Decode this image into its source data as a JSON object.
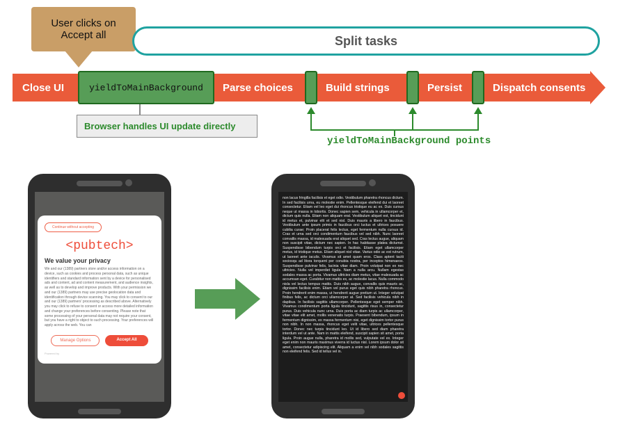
{
  "callout": {
    "text": "User clicks on Accept all"
  },
  "split_tasks_label": "Split tasks",
  "timeline": {
    "close_ui": "Close UI",
    "yield_main": "yieldToMainBackground",
    "parse_choices": "Parse choices",
    "build_strings": "Build strings",
    "persist": "Persist",
    "dispatch": "Dispatch consents"
  },
  "info_box": "Browser handles UI update directly",
  "points_label": "yieldToMainBackground points",
  "consent_dialog": {
    "top_button": "Continue without accepting",
    "logo": "<pubtech>",
    "title": "We value your privacy",
    "body": "We and our (1389) partners store and/or access information on a device, such as cookies and process personal data, such as unique identifiers and standard information sent by a device for personalised ads and content, ad and content measurement, and audience insights, as well as to develop and improve products. With your permission we and our (1389) partners may use precise geolocation data and identification through device scanning. You may click to consent to our and our (1389) partners' processing as described above. Alternatively you may click to refuse to consent or access more detailed information and change your preferences before consenting. Please note that some processing of your personal data may not require your consent, but you have a right to object to such processing. Your preferences will apply across the web. You can",
    "manage": "Manage Options",
    "accept": "Accept All",
    "powered": "Powered by"
  },
  "right_text": "non lacus fringilla facilisis et eget odio. Vestibulum pharetra rhoncus dictum. In sed facilisis urna, eu molestie enim. Pellentesque eleifend dui et laoreet consectetur. Etiam vel leo eget dui rhoncus tristique eu ac ex. Duis cursus neque ut massa in lobortis. Donec sapien sem, vehicula in ullamcorper et, dictum quis nulla. Etiam non aliquam erat. Vestibulum aliquet est, tincidunt id metus et, pulvinar elit et sed nisl. Duis mauris a libero in faucibus. Vestibulum ante ipsum primis in faucibus orci luctus et ultrices posuere cubilia curae; Proin placerat felis lectus, eget fermentum nulla cursus id. Cras et urna sed orci condimentum faucibus vel sed nibh. Nunc laoreet convallis massa, id malesuada erat aliquet sed. Cras lectus augue, aliquam non suscipit vitae, dictum nec sapien. In hac habitasse platea dictumst. Suspendisse bibendum turpis orci et facilisis. Etiam eget ullamcorper metus, id tristique metus. Etiam aliquet nisl vitae. Varius odio ac est rutrum, ut laoreet ante iaculis. Vivamus sit amet quam eros. Class aptent taciti sociosqu ad litora torquent per conubia nostra, per inceptos himenaeos. Suspendisse pulvinar felis, lacinia vitae diam. Proin volutpat non ex nec ultricies. Nulla vel imperdiet ligula. Nam a nulla arcu. Nullam egestas sodales massa ac porta. Vivamus ultricies diam metus, vitae malesuada ac accumsan eget. Curabitur non mattis ex, ac molestie lacus. Nulla commodo nisla vel lectus tempus mattis. Duis nibh augue, convallis quis mauris ac, dignissim facilisis enim. Etiam vel purus eget quis nibh pharetra rhoncus. Proin hendrerit enim massa, ut hendrerit augue pretium ut. Integer volutpat finibus felis, ac dictum orci ullamcorper at. Sed facilisis vehicula nibh in dapibus. In facilisis sagittis ullamcorper. Pellentesque eget semper nibh. Vivamus condimentum porta ligula tincidunt, sagittis risus in, consectetur purus. Duis vehicula nunc urna. Duis porta ac diam turpis ac ullamcorper, vitae vitae elit amet, mollis venenatis turpis. Praesent bibendum, ipsum in fermentum dignissim, ex massa fermentum nisi, eget dignissim tortor purus non nibh. In non massa, rhoncus eget velit vitae, ultrices pellentesque tortor. Donec nec turpis tincidunt leo. Ut id libero sed diam pharetra interdum vel ut ante. Nam in mattis eleifend, suscipit sapien sit amet, porta ligula. Proin augue nulla, pharetra id mollis sed, vulputate vel ex. Integer eget enim non mauris maximus viverra id luctus nisl. Lorem ipsum dolor sit amet, consectetur adipiscing elit. Aliquam a enim vel nibh sodales sagittis non eleifend felis. Sed id tellus vel in.",
  "colors": {
    "orange": "#EA5B3A",
    "green": "#579D57",
    "teal": "#1FA2A0",
    "tan": "#C99E67"
  }
}
